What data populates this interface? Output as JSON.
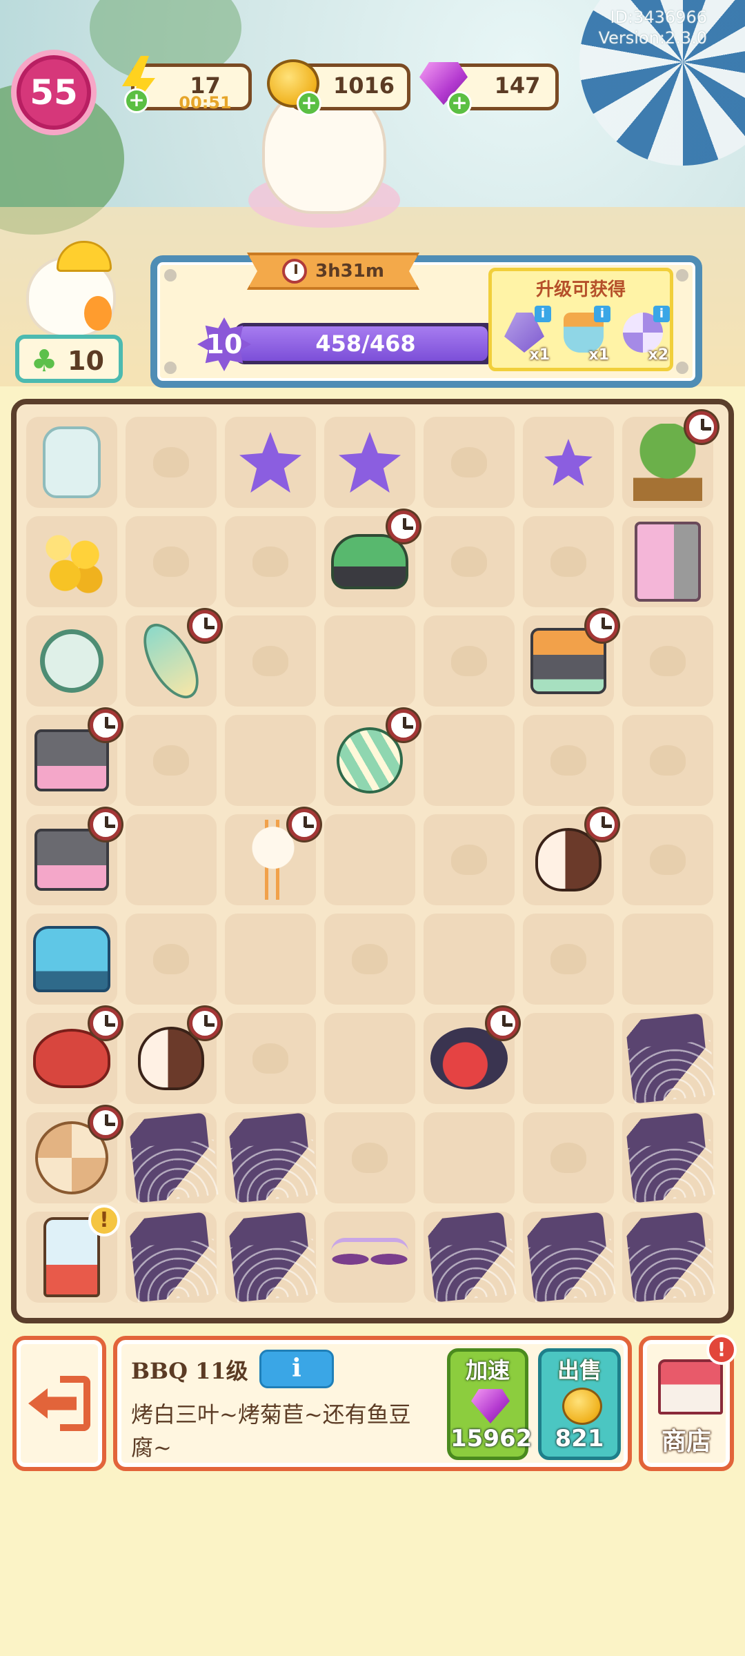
{
  "meta": {
    "id_text": "ID:3436966",
    "version_text": "Version:2.3.0"
  },
  "player": {
    "level": "55"
  },
  "resources": {
    "energy": {
      "value": "17",
      "timer": "00:51"
    },
    "coins": {
      "value": "1016"
    },
    "gems": {
      "value": "147"
    }
  },
  "clover": {
    "value": "10"
  },
  "level_panel": {
    "timer": "3h31m",
    "level": "10",
    "xp_text": "458/468",
    "xp_progress": 0.979,
    "reward_title": "升级可获得",
    "rewards": [
      {
        "icon": "shovel-icon",
        "qty": "x1"
      },
      {
        "icon": "sand-bucket-icon",
        "qty": "x1"
      },
      {
        "icon": "beach-ball-icon",
        "qty": "x2"
      }
    ]
  },
  "board": {
    "rows": [
      [
        "jar",
        "empty",
        "star",
        "star",
        "empty",
        "star-small",
        "orange-tree"
      ],
      [
        "coins",
        "empty",
        "empty",
        "jetski",
        "empty",
        "empty",
        "curtain"
      ],
      [
        "alarm-clock",
        "surfboard",
        "empty",
        "lit",
        "empty",
        "bbq-grill",
        "empty"
      ],
      [
        "grill",
        "empty",
        "lit",
        "ball",
        "lit",
        "empty",
        "empty"
      ],
      [
        "grill",
        "lit",
        "crane",
        "lit",
        "empty",
        "brown-bird",
        "empty"
      ],
      [
        "bus",
        "empty",
        "lit",
        "empty",
        "lit",
        "empty",
        "lit"
      ],
      [
        "crab",
        "brown-bird",
        "empty",
        "lit",
        "red-bird",
        "lit",
        "web"
      ],
      [
        "hermit-shell",
        "web",
        "web",
        "empty",
        "lit",
        "empty",
        "web"
      ],
      [
        "blender",
        "web",
        "web",
        "sunglasses",
        "web",
        "web",
        "web"
      ]
    ],
    "timer_badges": [
      "0-6",
      "1-3",
      "2-1",
      "2-5",
      "3-0",
      "3-3",
      "4-0",
      "4-2",
      "4-5",
      "6-0",
      "6-1",
      "6-4",
      "7-0"
    ],
    "alert_badges": [
      "8-0"
    ]
  },
  "bottom": {
    "item_title": "BBQ 11级",
    "info_label": "i",
    "item_desc": "烤白三叶~烤菊苣~还有鱼豆腐~",
    "speed_label": "加速",
    "speed_cost": "15962",
    "sell_label": "出售",
    "sell_value": "821",
    "shop_label": "商店",
    "shop_alert": "!"
  }
}
